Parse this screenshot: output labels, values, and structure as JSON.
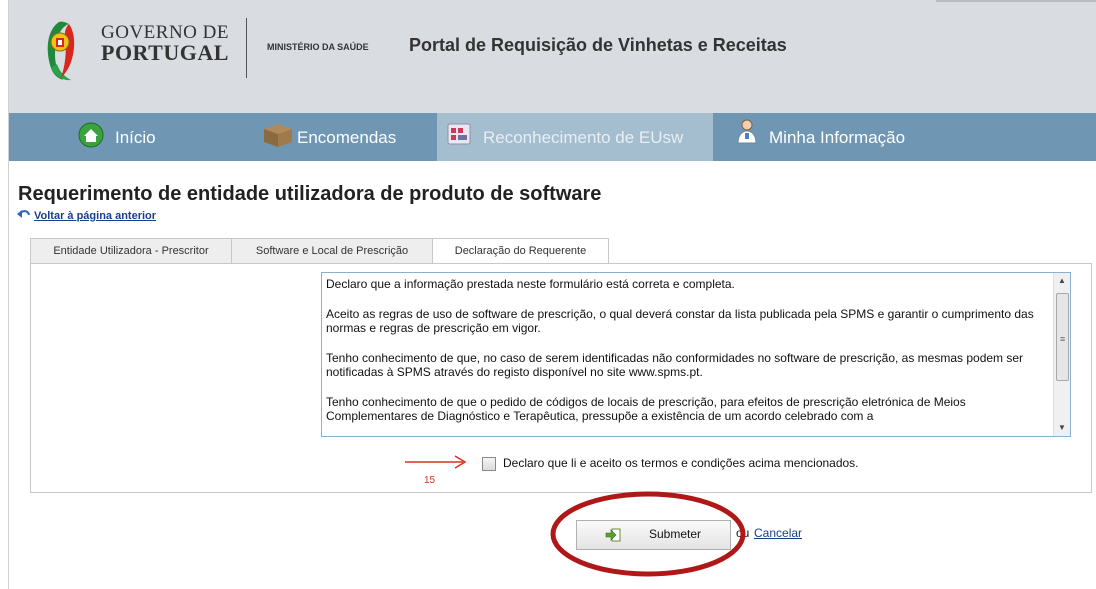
{
  "header": {
    "gov_line1": "GOVERNO DE",
    "gov_line2": "PORTUGAL",
    "ministry": "MINISTÉRIO DA SAÚDE",
    "portal_title": "Portal de Requisição de Vinhetas e Receitas"
  },
  "nav": {
    "items": [
      {
        "label": "Início",
        "icon": "home-icon"
      },
      {
        "label": "Encomendas",
        "icon": "box-icon"
      },
      {
        "label": "Reconhecimento de EUsw",
        "icon": "software-icon",
        "active": true
      },
      {
        "label": "Minha Informação",
        "icon": "user-icon"
      }
    ]
  },
  "page": {
    "title": "Requerimento de entidade utilizadora de produto de software",
    "back_link": "Voltar à página anterior"
  },
  "tabs": [
    {
      "label": "Entidade Utilizadora - Prescritor"
    },
    {
      "label": "Software e Local de Prescrição"
    },
    {
      "label": "Declaração do Requerente",
      "active": true
    }
  ],
  "declaration": {
    "paragraphs": [
      "Declaro que a informação prestada neste formulário está correta e completa.",
      "Aceito as regras de uso de software de prescrição, o qual deverá constar da lista publicada pela SPMS e garantir o cumprimento das normas e regras de prescrição em vigor.",
      "Tenho conhecimento de que, no caso de serem identificadas não conformidades no software de prescrição, as mesmas podem ser notificadas à SPMS através do registo disponível no site www.spms.pt.",
      "Tenho conhecimento de que o pedido de códigos de locais de prescrição, para efeitos de prescrição eletrónica de Meios Complementares de Diagnóstico e Terapêutica, pressupõe a existência de um acordo celebrado com a"
    ],
    "checkbox_label": "Declaro que li e aceito os termos e condições acima mencionados.",
    "checkbox_checked": false
  },
  "annotation": {
    "number": "15",
    "color": "#d83020",
    "ellipse_color": "#b01818"
  },
  "actions": {
    "submit_label": "Submeter",
    "or_text": "ou",
    "cancel_label": "Cancelar"
  },
  "colors": {
    "header_bg": "#d9dce0",
    "nav_bg": "#6f97b3",
    "nav_active_bg": "#a4bed0",
    "link": "#1a3e8c"
  }
}
